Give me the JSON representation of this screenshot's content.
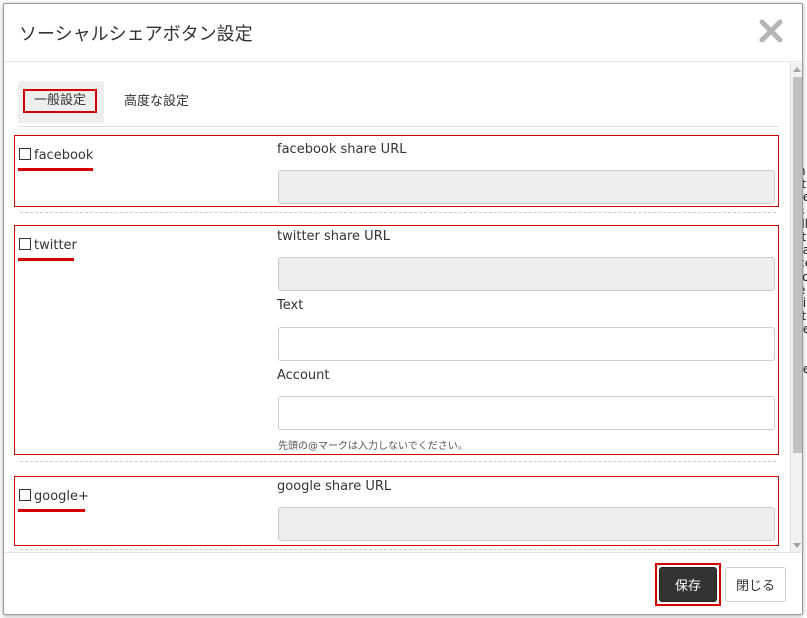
{
  "dialog": {
    "title": "ソーシャルシェアボタン設定"
  },
  "tabs": [
    {
      "label": "一般設定",
      "active": true
    },
    {
      "label": "高度な設定",
      "active": false
    }
  ],
  "sections": {
    "facebook": {
      "checkbox_label": "facebook",
      "checked": false,
      "url_label": "facebook share URL",
      "url_value": ""
    },
    "twitter": {
      "checkbox_label": "twitter",
      "checked": false,
      "url_label": "twitter share URL",
      "url_value": "",
      "text_label": "Text",
      "text_value": "",
      "account_label": "Account",
      "account_value": "",
      "account_help": "先頭の@マークは入力しないでください。"
    },
    "google": {
      "checkbox_label": "google+",
      "checked": false,
      "url_label": "google share URL",
      "url_value": ""
    }
  },
  "footer": {
    "save_label": "保存",
    "close_label": "閉じる"
  },
  "background": {
    "edge_letters": "n\nit\nte\ns\nill\nit\nta\nce\nfo\ne\nti\nit\nte\n\nt\nte"
  },
  "colors": {
    "highlight": "#d40000",
    "save_button": "#333333",
    "readonly_input": "#eeeeee"
  },
  "icons": {
    "close": "close-x-icon",
    "checkbox": "checkbox-icon"
  }
}
